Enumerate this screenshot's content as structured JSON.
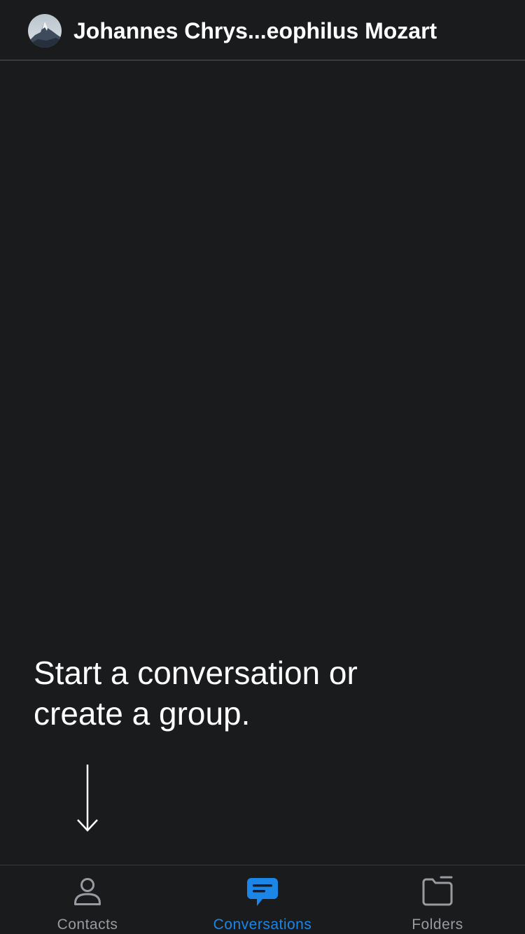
{
  "header": {
    "title": "Johannes Chrys...eophilus Mozart"
  },
  "empty_state": {
    "line1": "Start a conversation or",
    "line2": "create a group."
  },
  "tabbar": {
    "active_tab": "Conversations",
    "accent_color": "#1b86e8",
    "inactive_color": "#9a9ba0",
    "tabs": [
      {
        "label": "Contacts",
        "icon": "person-icon"
      },
      {
        "label": "Conversations",
        "icon": "chat-bubble-icon"
      },
      {
        "label": "Folders",
        "icon": "folder-icon"
      }
    ]
  },
  "colors": {
    "background": "#1a1b1d",
    "divider": "#3a3b3e",
    "text": "#ffffff"
  }
}
